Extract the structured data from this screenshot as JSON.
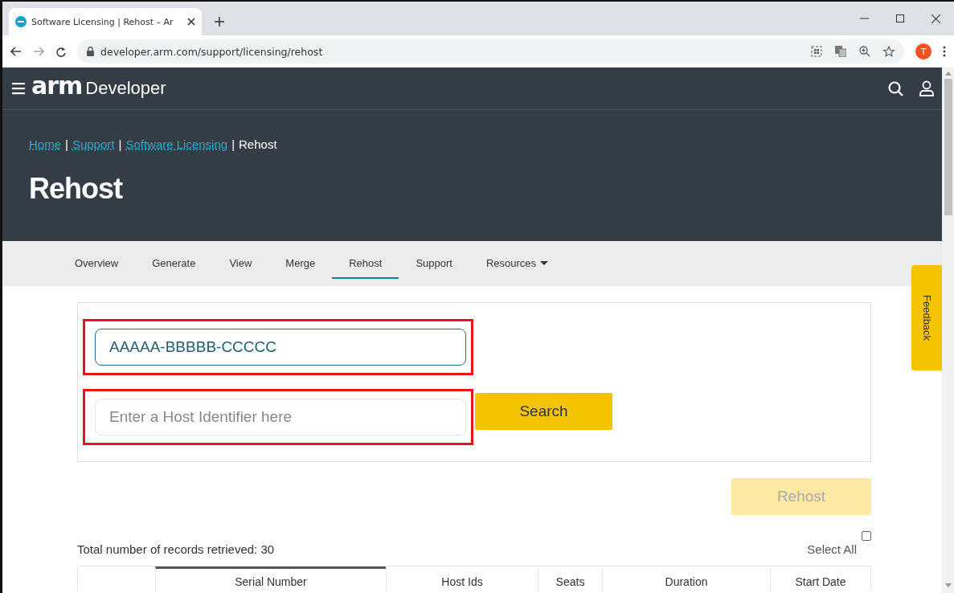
{
  "browser": {
    "tab_title": "Software Licensing | Rehost – Ar",
    "url": "developer.arm.com/support/licensing/rehost",
    "avatar_letter": "T"
  },
  "site_header": {
    "logo": "arm",
    "product": "Developer"
  },
  "breadcrumbs": [
    {
      "label": "Home",
      "kind": "link"
    },
    {
      "label": "Support",
      "kind": "link"
    },
    {
      "label": "Software Licensing",
      "kind": "link"
    },
    {
      "label": "Rehost",
      "kind": "current"
    }
  ],
  "breadcrumb_separator": "|",
  "page_title": "Rehost",
  "nav": [
    {
      "label": "Overview",
      "selected": false,
      "kind": "link"
    },
    {
      "label": "Generate",
      "selected": false,
      "kind": "link"
    },
    {
      "label": "View",
      "selected": false,
      "kind": "link"
    },
    {
      "label": "Merge",
      "selected": false,
      "kind": "link"
    },
    {
      "label": "Rehost",
      "selected": true,
      "kind": "link"
    },
    {
      "label": "Support",
      "selected": false,
      "kind": "link"
    },
    {
      "label": "Resources",
      "selected": false,
      "kind": "dropdown"
    }
  ],
  "form": {
    "serial_field": {
      "value": "AAAAA-BBBBB-CCCCC",
      "highlighted": true
    },
    "host_field": {
      "placeholder": "Enter a Host Identifier here",
      "highlighted": true
    },
    "search_button": "Search",
    "rehost_button": {
      "label": "Rehost",
      "disabled": true
    }
  },
  "records": {
    "summary": "Total number of records retrieved: 30",
    "select_all": {
      "label": "Select All",
      "checked": false
    },
    "columns": [
      {
        "label": "Serial Number",
        "sorted": true
      },
      {
        "label": "Host Ids",
        "sorted": false
      },
      {
        "label": "Seats",
        "sorted": false
      },
      {
        "label": "Duration",
        "sorted": false
      },
      {
        "label": "Start Date",
        "sorted": false
      }
    ]
  },
  "feedback_tab": "Feedback"
}
